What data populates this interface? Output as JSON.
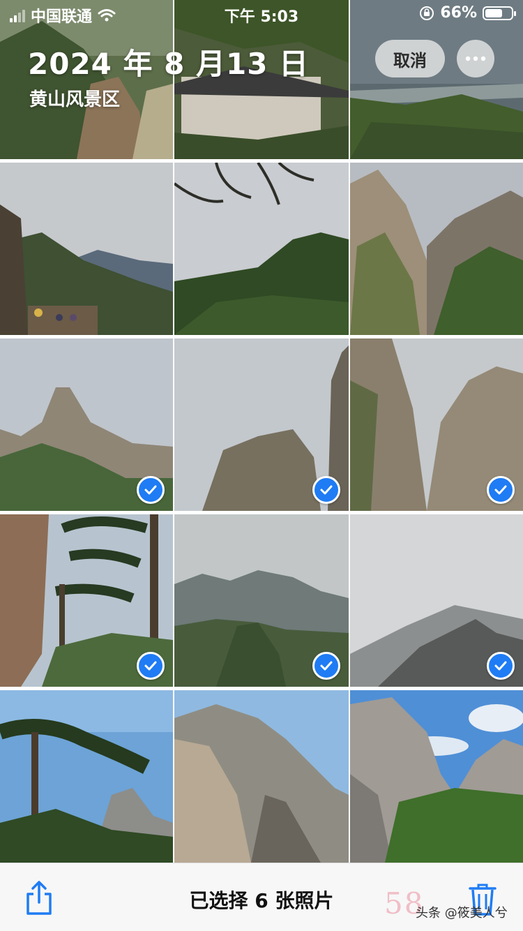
{
  "status_bar": {
    "carrier": "中国联通",
    "time": "下午 5:03",
    "battery": "66%",
    "battery_level": 0.66
  },
  "header": {
    "date": "2024 年 8 月13 日",
    "location": "黄山风景区",
    "cancel_label": "取消",
    "more_icon": "ellipsis-icon"
  },
  "photos": [
    {
      "selected": false
    },
    {
      "selected": false
    },
    {
      "selected": false
    },
    {
      "selected": false
    },
    {
      "selected": false
    },
    {
      "selected": false
    },
    {
      "selected": true
    },
    {
      "selected": true
    },
    {
      "selected": true
    },
    {
      "selected": false
    },
    {
      "selected": true
    },
    {
      "selected": true
    },
    {
      "selected": false
    },
    {
      "selected": false
    },
    {
      "selected": false
    }
  ],
  "toolbar": {
    "selection_label": "已选择 6 张照片",
    "share_icon": "share-icon",
    "delete_icon": "trash-icon"
  },
  "watermark": {
    "number": "58",
    "text": "头条 @筱美人兮"
  },
  "colors": {
    "accent": "#1f7cf4"
  }
}
